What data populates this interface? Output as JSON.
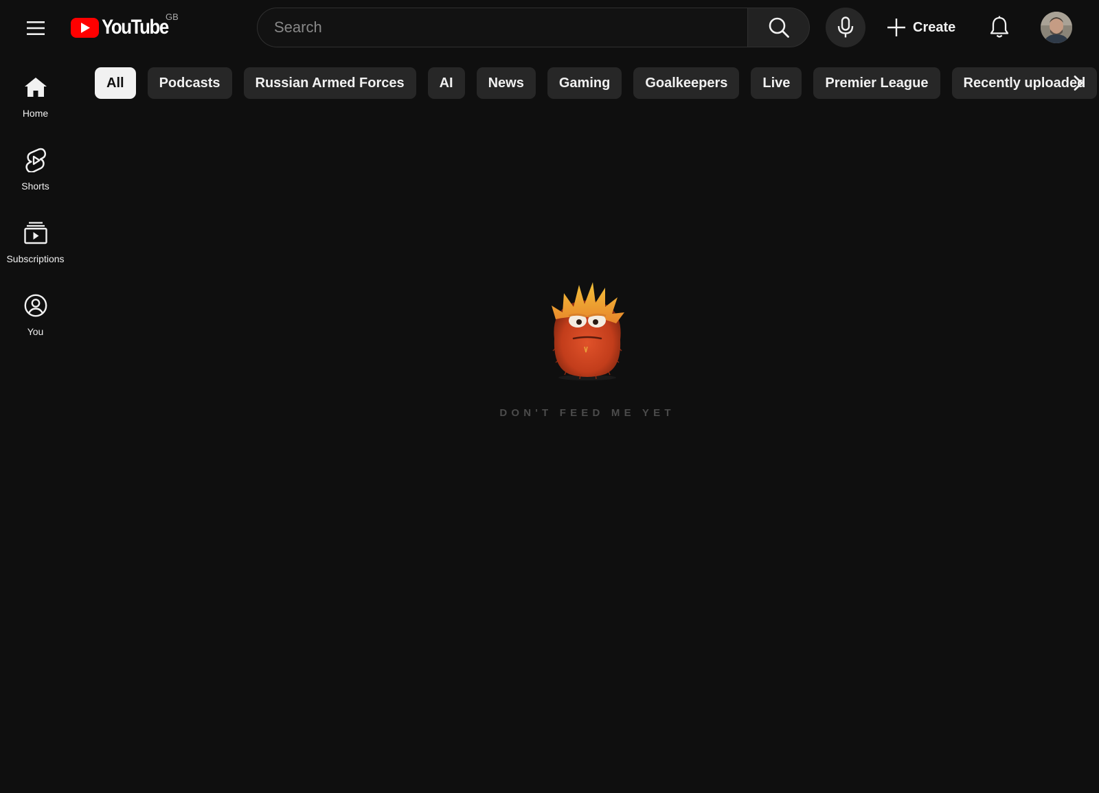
{
  "masthead": {
    "logo_text": "YouTube",
    "country_code": "GB",
    "search_placeholder": "Search",
    "search_value": "",
    "create_label": "Create"
  },
  "guide": {
    "items": [
      {
        "label": "Home",
        "icon": "home-icon"
      },
      {
        "label": "Shorts",
        "icon": "shorts-icon"
      },
      {
        "label": "Subscriptions",
        "icon": "subscriptions-icon"
      },
      {
        "label": "You",
        "icon": "you-icon"
      }
    ]
  },
  "chips": [
    {
      "label": "All",
      "selected": true
    },
    {
      "label": "Podcasts",
      "selected": false
    },
    {
      "label": "Russian Armed Forces",
      "selected": false
    },
    {
      "label": "AI",
      "selected": false
    },
    {
      "label": "News",
      "selected": false
    },
    {
      "label": "Gaming",
      "selected": false
    },
    {
      "label": "Goalkeepers",
      "selected": false
    },
    {
      "label": "Live",
      "selected": false
    },
    {
      "label": "Premier League",
      "selected": false
    },
    {
      "label": "Recently uploaded",
      "selected": false
    }
  ],
  "empty_state": {
    "message": "DON'T FEED ME YET",
    "illustration": "orange-furry-monster"
  },
  "colors": {
    "background": "#0f0f0f",
    "chip": "#272727",
    "chip_active": "#f1f1f1",
    "brand_red": "#ff0000",
    "empty_text": "#4b4b4b"
  }
}
